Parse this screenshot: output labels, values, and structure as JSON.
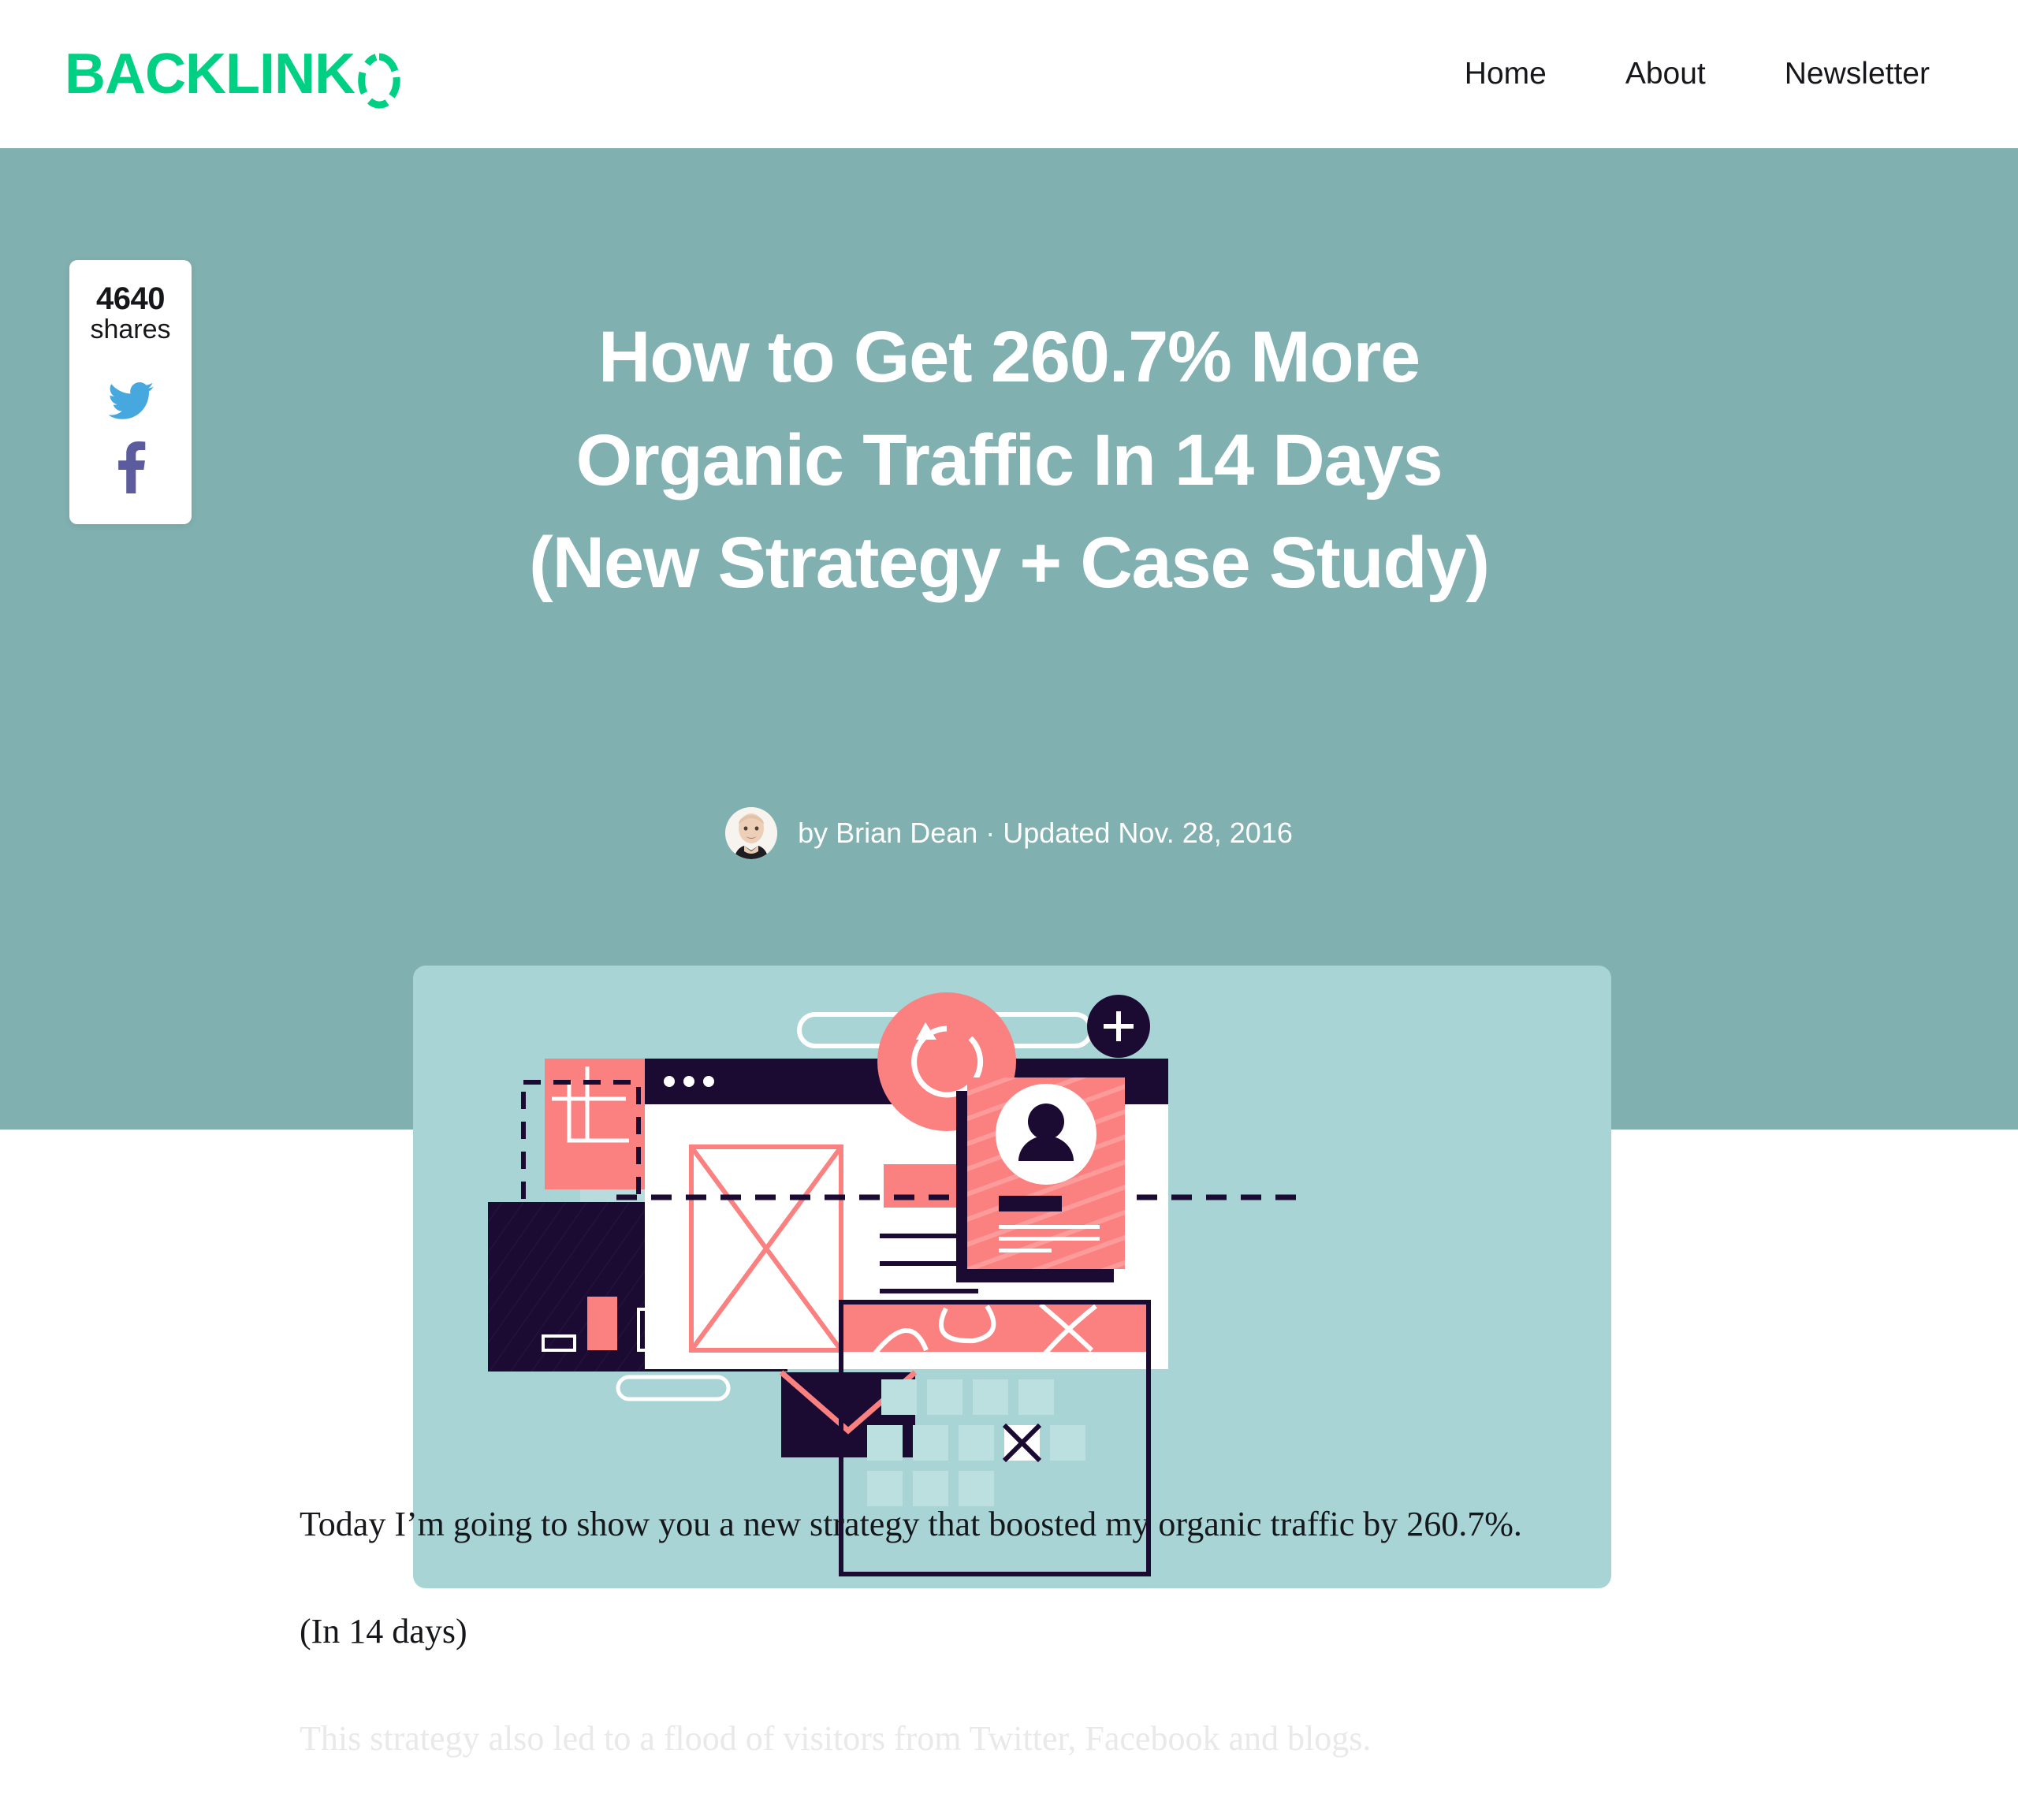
{
  "header": {
    "logo_text": "BACKLINK",
    "logo_ring_icon": "segmented-ring-icon",
    "logo_color": "#00d084",
    "nav": [
      {
        "label": "Home",
        "name": "nav-link-home"
      },
      {
        "label": "About",
        "name": "nav-link-about"
      },
      {
        "label": "Newsletter",
        "name": "nav-link-newsletter"
      }
    ]
  },
  "hero": {
    "background_color": "#81b0b0",
    "title_lines": [
      "How to Get 260.7% More",
      "Organic Traffic In 14 Days",
      "(New Strategy + Case Study)"
    ],
    "byline": "by Brian Dean · Updated Nov. 28, 2016",
    "author_name": "Brian Dean",
    "updated_date": "Nov. 28, 2016",
    "avatar_alt": "Brian Dean avatar"
  },
  "share": {
    "count": "4640",
    "label": "shares",
    "twitter_icon": "twitter-bird-icon",
    "twitter_color": "#46a8de",
    "facebook_icon": "facebook-f-icon",
    "facebook_color": "#5b5b9e"
  },
  "illustration": {
    "alt": "flat design illustration of browser wireframe, crop tool, bar chart, profile card, calendar and envelope",
    "background_color": "#a8d4d6",
    "accent_coral": "#fb8080",
    "accent_navy": "#1b0b33",
    "elements": [
      "crop-tool",
      "dashed-selection-box",
      "browser-window",
      "wireframe-image-placeholder",
      "refresh-badge",
      "pill-bar",
      "profile-card",
      "plus-badge",
      "bar-chart-panel",
      "envelope",
      "calendar"
    ]
  },
  "article": {
    "paragraphs": [
      {
        "text": "Today I’m going to show you a new strategy that boosted my organic traffic by 260.7%.",
        "faded": false
      },
      {
        "text": "(In 14 days)",
        "faded": false
      },
      {
        "text": "This strategy also led to a flood of visitors from Twitter, Facebook and blogs.",
        "faded": true
      }
    ]
  }
}
